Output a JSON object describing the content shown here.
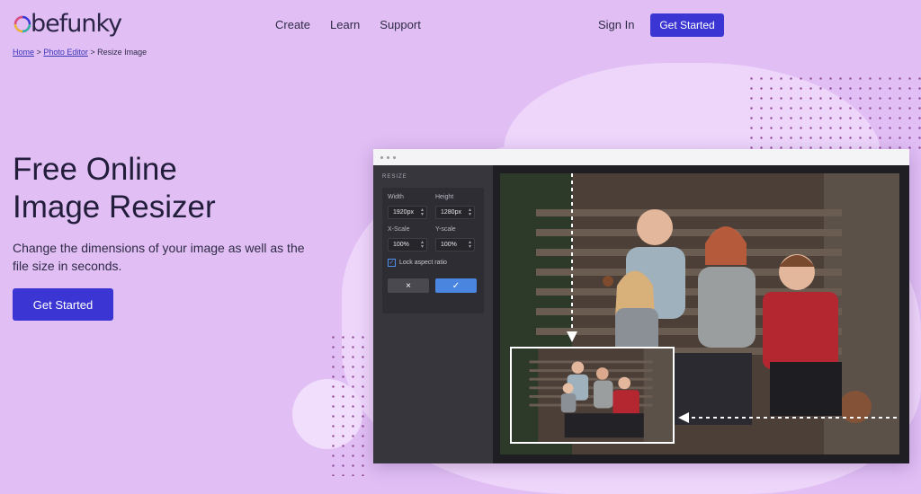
{
  "brand": {
    "name": "befunky"
  },
  "nav": {
    "items": [
      "Create",
      "Learn",
      "Support"
    ]
  },
  "header": {
    "sign_in": "Sign In",
    "get_started": "Get Started"
  },
  "breadcrumb": {
    "home": "Home",
    "sep1": ">",
    "photo_editor": "Photo Editor",
    "sep2": ">",
    "current": "Resize Image"
  },
  "hero": {
    "title_line1": "Free Online",
    "title_line2": "Image Resizer",
    "subtitle": "Change the dimensions of your image as well as the file size in seconds.",
    "cta": "Get Started"
  },
  "editor": {
    "panel_title": "RESIZE",
    "width_label": "Width",
    "height_label": "Height",
    "width_value": "1920px",
    "height_value": "1280px",
    "xscale_label": "X-Scale",
    "yscale_label": "Y-scale",
    "xscale_value": "100%",
    "yscale_value": "100%",
    "lock_label": "Lock aspect ratio",
    "lock_checked": true,
    "cancel_icon": "×",
    "apply_icon": "✓"
  },
  "colors": {
    "background": "#e1bff5",
    "accent": "#3b35d4",
    "apply": "#4a86e0"
  }
}
